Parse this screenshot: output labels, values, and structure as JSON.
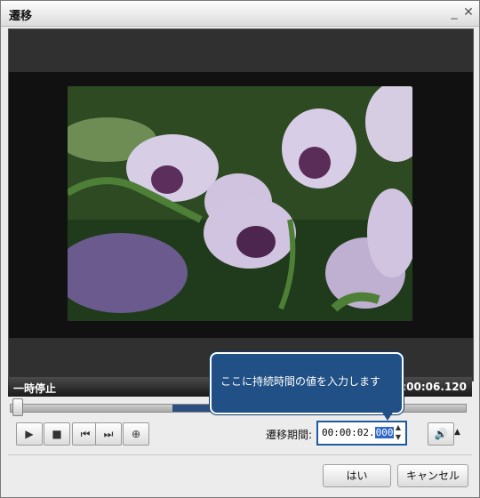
{
  "window": {
    "title": "遷移"
  },
  "titlebar_icons": {
    "minimize": "minimize-icon",
    "close": "close-icon"
  },
  "player": {
    "status": "一時停止",
    "total_time": "00:00:06.120",
    "seek_fraction": 0.0
  },
  "controls": {
    "play": "play-icon",
    "stop": "stop-icon",
    "prev": "previous-icon",
    "next": "next-icon",
    "zoom": "zoom-icon",
    "volume": "speaker-icon"
  },
  "transition": {
    "label": "遷移期間:",
    "value_main": "00:00:02.",
    "value_selected": "000"
  },
  "tooltip": {
    "text": "ここに持続時間の値を入力します"
  },
  "dialog_buttons": {
    "ok": "はい",
    "cancel": "キャンセル"
  },
  "colors": {
    "accent": "#205085",
    "selection": "#3168c6"
  }
}
